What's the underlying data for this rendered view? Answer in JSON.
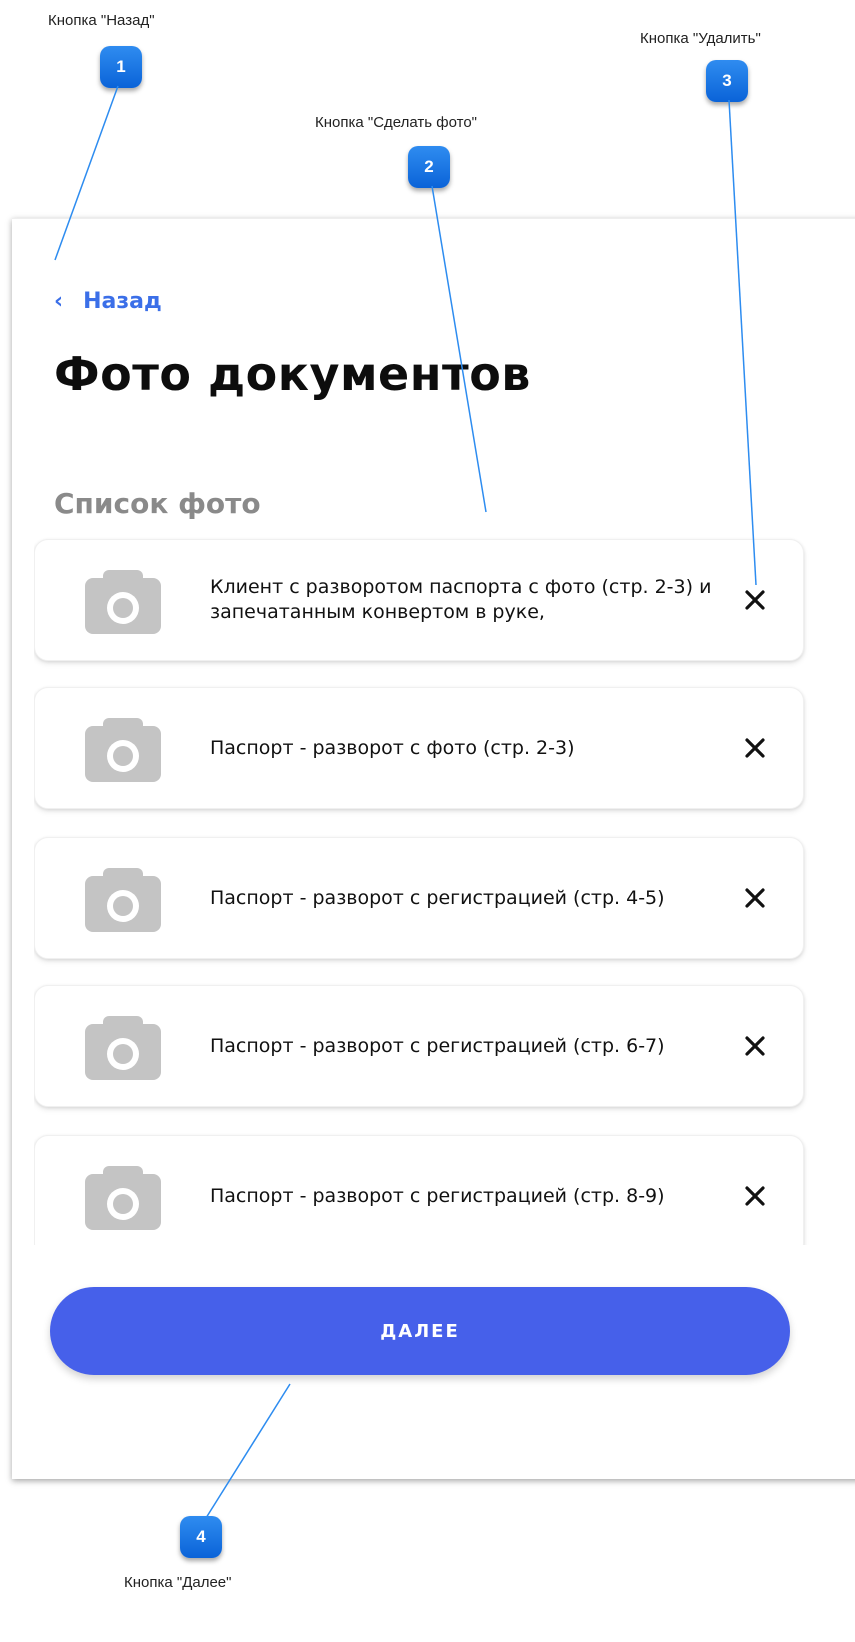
{
  "annotations": [
    {
      "number": "1",
      "label": "Кнопка \"Назад\""
    },
    {
      "number": "2",
      "label": "Кнопка \"Сделать фото\""
    },
    {
      "number": "3",
      "label": "Кнопка \"Удалить\""
    },
    {
      "number": "4",
      "label": "Кнопка \"Далее\""
    }
  ],
  "screen": {
    "back_label": "Назад",
    "back_chevron": "‹",
    "title": "Фото документов",
    "section_title": "Список фото",
    "items": [
      {
        "text": "Клиент с разворотом паспорта с фото (стр. 2-3) и запечатанным конвертом в руке,",
        "icon": "camera-icon",
        "action_icon": "close-icon"
      },
      {
        "text": "Паспорт - разворот с фото (стр. 2-3)",
        "icon": "camera-icon",
        "action_icon": "close-icon"
      },
      {
        "text": "Паспорт - разворот с регистрацией (стр. 4-5)",
        "icon": "camera-icon",
        "action_icon": "close-icon"
      },
      {
        "text": "Паспорт - разворот с регистрацией (стр. 6-7)",
        "icon": "camera-icon",
        "action_icon": "close-icon"
      },
      {
        "text": "Паспорт - разворот с регистрацией (стр. 8-9)",
        "icon": "camera-icon",
        "action_icon": "close-icon"
      }
    ],
    "next_label": "ДАЛЕЕ"
  },
  "colors": {
    "accent": "#4660ea",
    "link": "#3b6fe8",
    "badge": "#1a73e8",
    "icon_gray": "#c4c4c4"
  }
}
